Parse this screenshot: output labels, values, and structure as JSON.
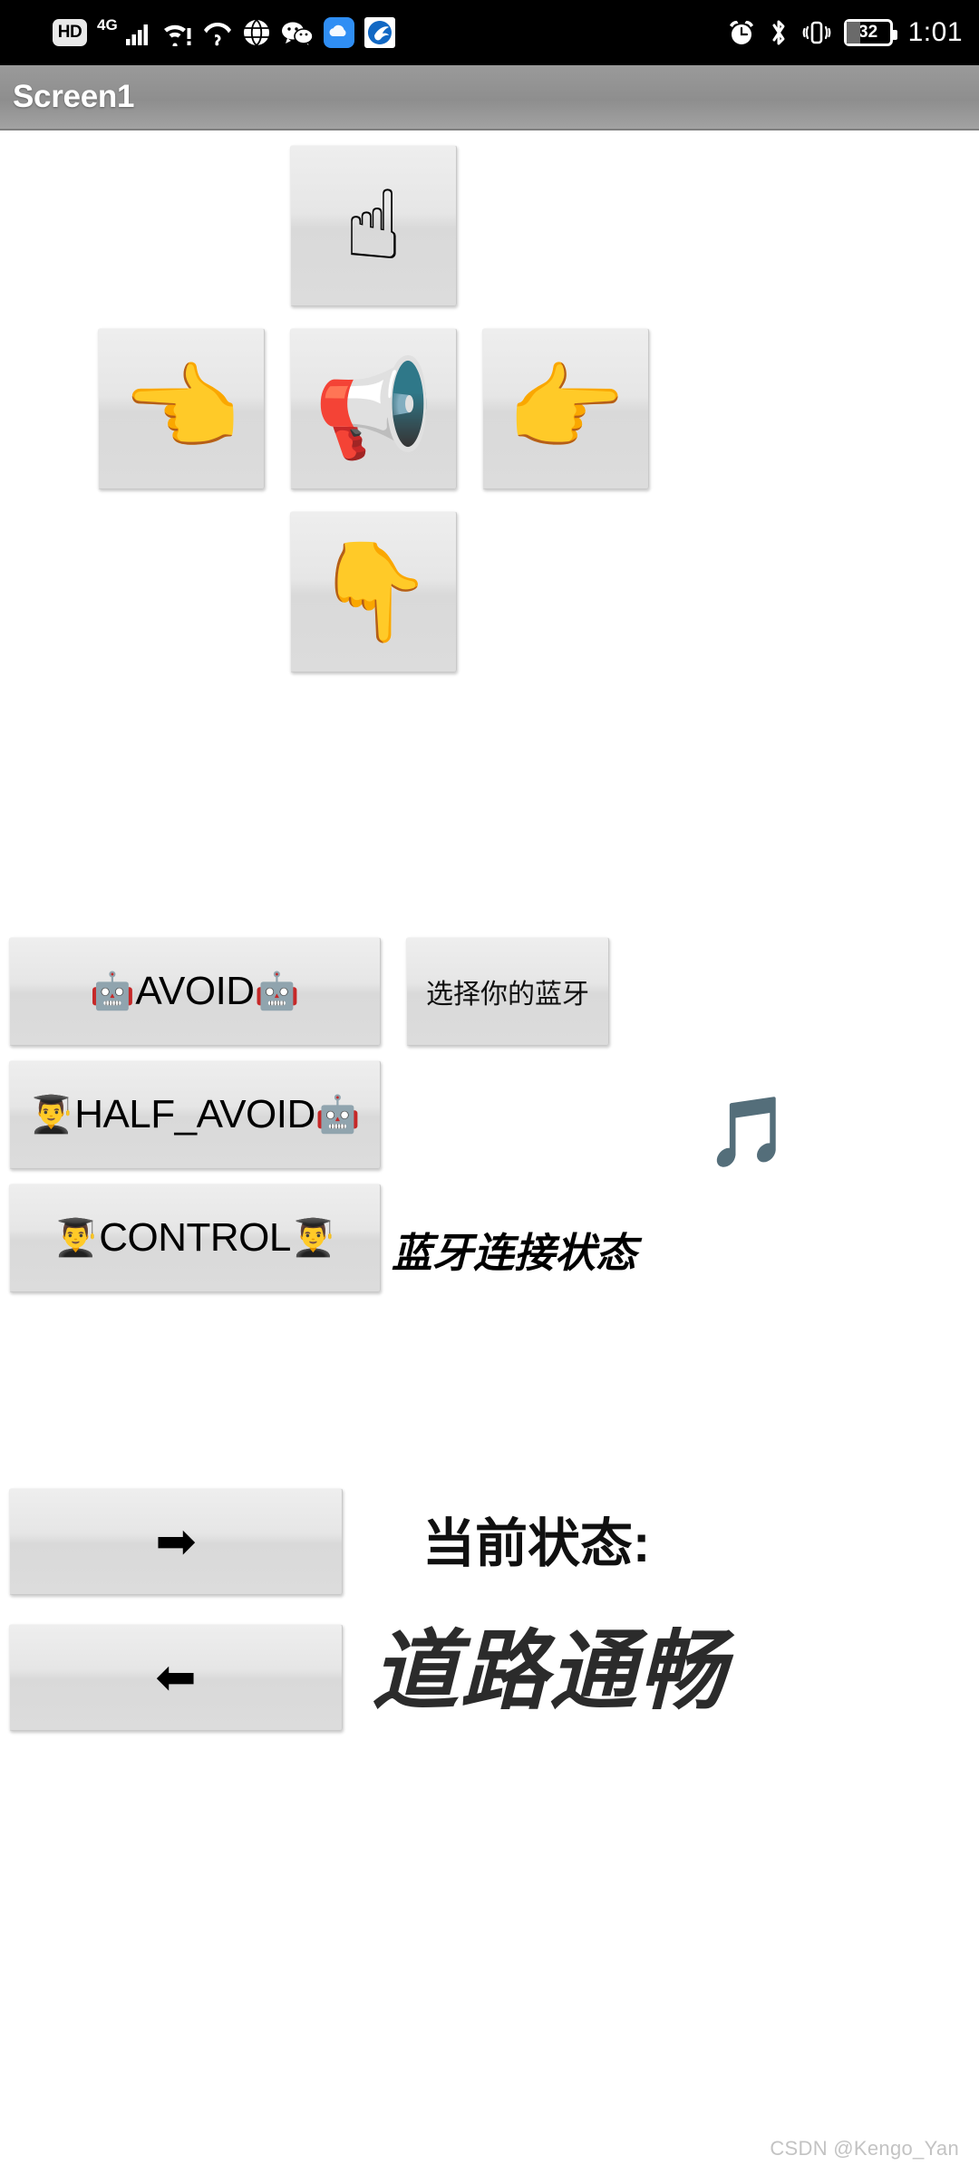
{
  "status_bar": {
    "left_icons": [
      {
        "name": "hd-icon",
        "label": "HD"
      },
      {
        "name": "cellular-4g-icon",
        "label": "4G"
      },
      {
        "name": "wifi-warning-icon",
        "label": "wifi"
      },
      {
        "name": "wifi-question-icon",
        "label": "wifi-unknown"
      },
      {
        "name": "globe-icon",
        "label": "globe"
      },
      {
        "name": "wechat-icon",
        "label": "wechat"
      },
      {
        "name": "cloud-app-icon",
        "label": "cloud"
      },
      {
        "name": "eagle-app-icon",
        "label": "eagle"
      }
    ],
    "right_icons": [
      {
        "name": "alarm-icon"
      },
      {
        "name": "bluetooth-icon"
      },
      {
        "name": "vibrate-icon"
      }
    ],
    "battery_level": "32",
    "time": "1:01"
  },
  "title_bar": {
    "title": "Screen1"
  },
  "dpad": {
    "up": {
      "icon": "☝",
      "name": "forward"
    },
    "left": {
      "icon": "👈",
      "name": "left"
    },
    "horn": {
      "icon": "📢",
      "name": "horn"
    },
    "right": {
      "icon": "👉",
      "name": "right"
    },
    "down": {
      "icon": "👇",
      "name": "backward"
    }
  },
  "modes": {
    "avoid": {
      "prefix_icon": "🤖",
      "label": "AVOID",
      "suffix_icon": "🤖"
    },
    "half_avoid": {
      "prefix_icon": "👨‍🎓",
      "label": "HALF_AVOID",
      "suffix_icon": "🤖"
    },
    "control": {
      "prefix_icon": "👨‍🎓",
      "label": "CONTROL",
      "suffix_icon": "👨‍🎓"
    }
  },
  "bluetooth": {
    "picker_label": "选择你的蓝牙",
    "status_label": "蓝牙连接状态",
    "music_icon": "🎵"
  },
  "arrows": {
    "right": {
      "icon": "➡",
      "name": "turn-right"
    },
    "left": {
      "icon": "⬅",
      "name": "turn-left"
    }
  },
  "current_status": {
    "label": "当前状态:",
    "value": "道路通畅"
  },
  "watermark": "CSDN @Kengo_Yan",
  "colors": {
    "title_bar": "#8e8e8e",
    "accent_blue": "#1e9fe3",
    "button_face": "#e3e3e3",
    "status_bar": "#000000"
  }
}
